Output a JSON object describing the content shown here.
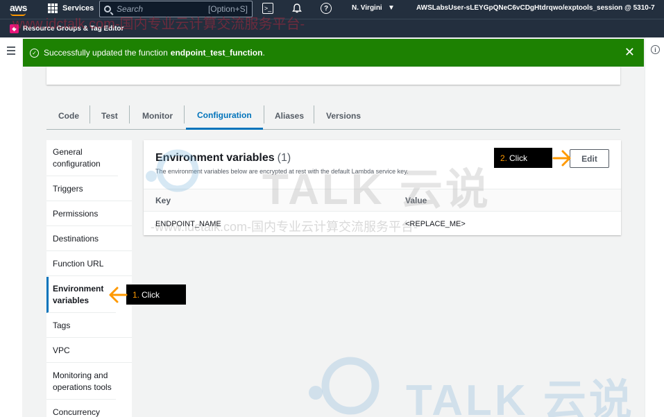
{
  "topnav": {
    "brand": "aws",
    "services_label": "Services",
    "search_placeholder": "Search",
    "search_shortcut": "[Option+S]",
    "region": "N. Virgini",
    "account": "AWSLabsUser-sLEYGpQNeC6vCDgHtdrqwo/exptools_session @ 5310-7"
  },
  "subnav": {
    "resource_groups_label": "Resource Groups & Tag Editor"
  },
  "flash": {
    "message": "Successfully updated the function",
    "function_name": "endpoint_test_function",
    "suffix": "."
  },
  "tabs": [
    "Code",
    "Test",
    "Monitor",
    "Configuration",
    "Aliases",
    "Versions"
  ],
  "active_tab": "Configuration",
  "sidemenu": [
    "General configuration",
    "Triggers",
    "Permissions",
    "Destinations",
    "Function URL",
    "Environment variables",
    "Tags",
    "VPC",
    "Monitoring and operations tools",
    "Concurrency"
  ],
  "active_menu": "Environment variables",
  "env": {
    "title": "Environment variables",
    "count": "(1)",
    "description": "The environment variables below are encrypted at rest with the default Lambda service key.",
    "edit_label": "Edit",
    "columns": {
      "key": "Key",
      "value": "Value"
    },
    "rows": [
      {
        "key": "ENDPOINT_NAME",
        "value": "<REPLACE_ME>"
      }
    ]
  },
  "callouts": {
    "step1": {
      "num": "1.",
      "text": "Click"
    },
    "step2": {
      "num": "2.",
      "text": "Click"
    }
  },
  "watermark": {
    "line1": "www.idctalk.com-国内专业云计算交流服务平台-",
    "line2": "-www.idctalk.com-国内专业云计算交流服务平台-",
    "logo_text": "TALK 云说",
    "logo_text_bottom": "TALK 云说"
  },
  "colors": {
    "nav_bg": "#232f3e",
    "success": "#1d8102",
    "accent": "#0073bb",
    "callout_arrow": "#ff9900"
  }
}
